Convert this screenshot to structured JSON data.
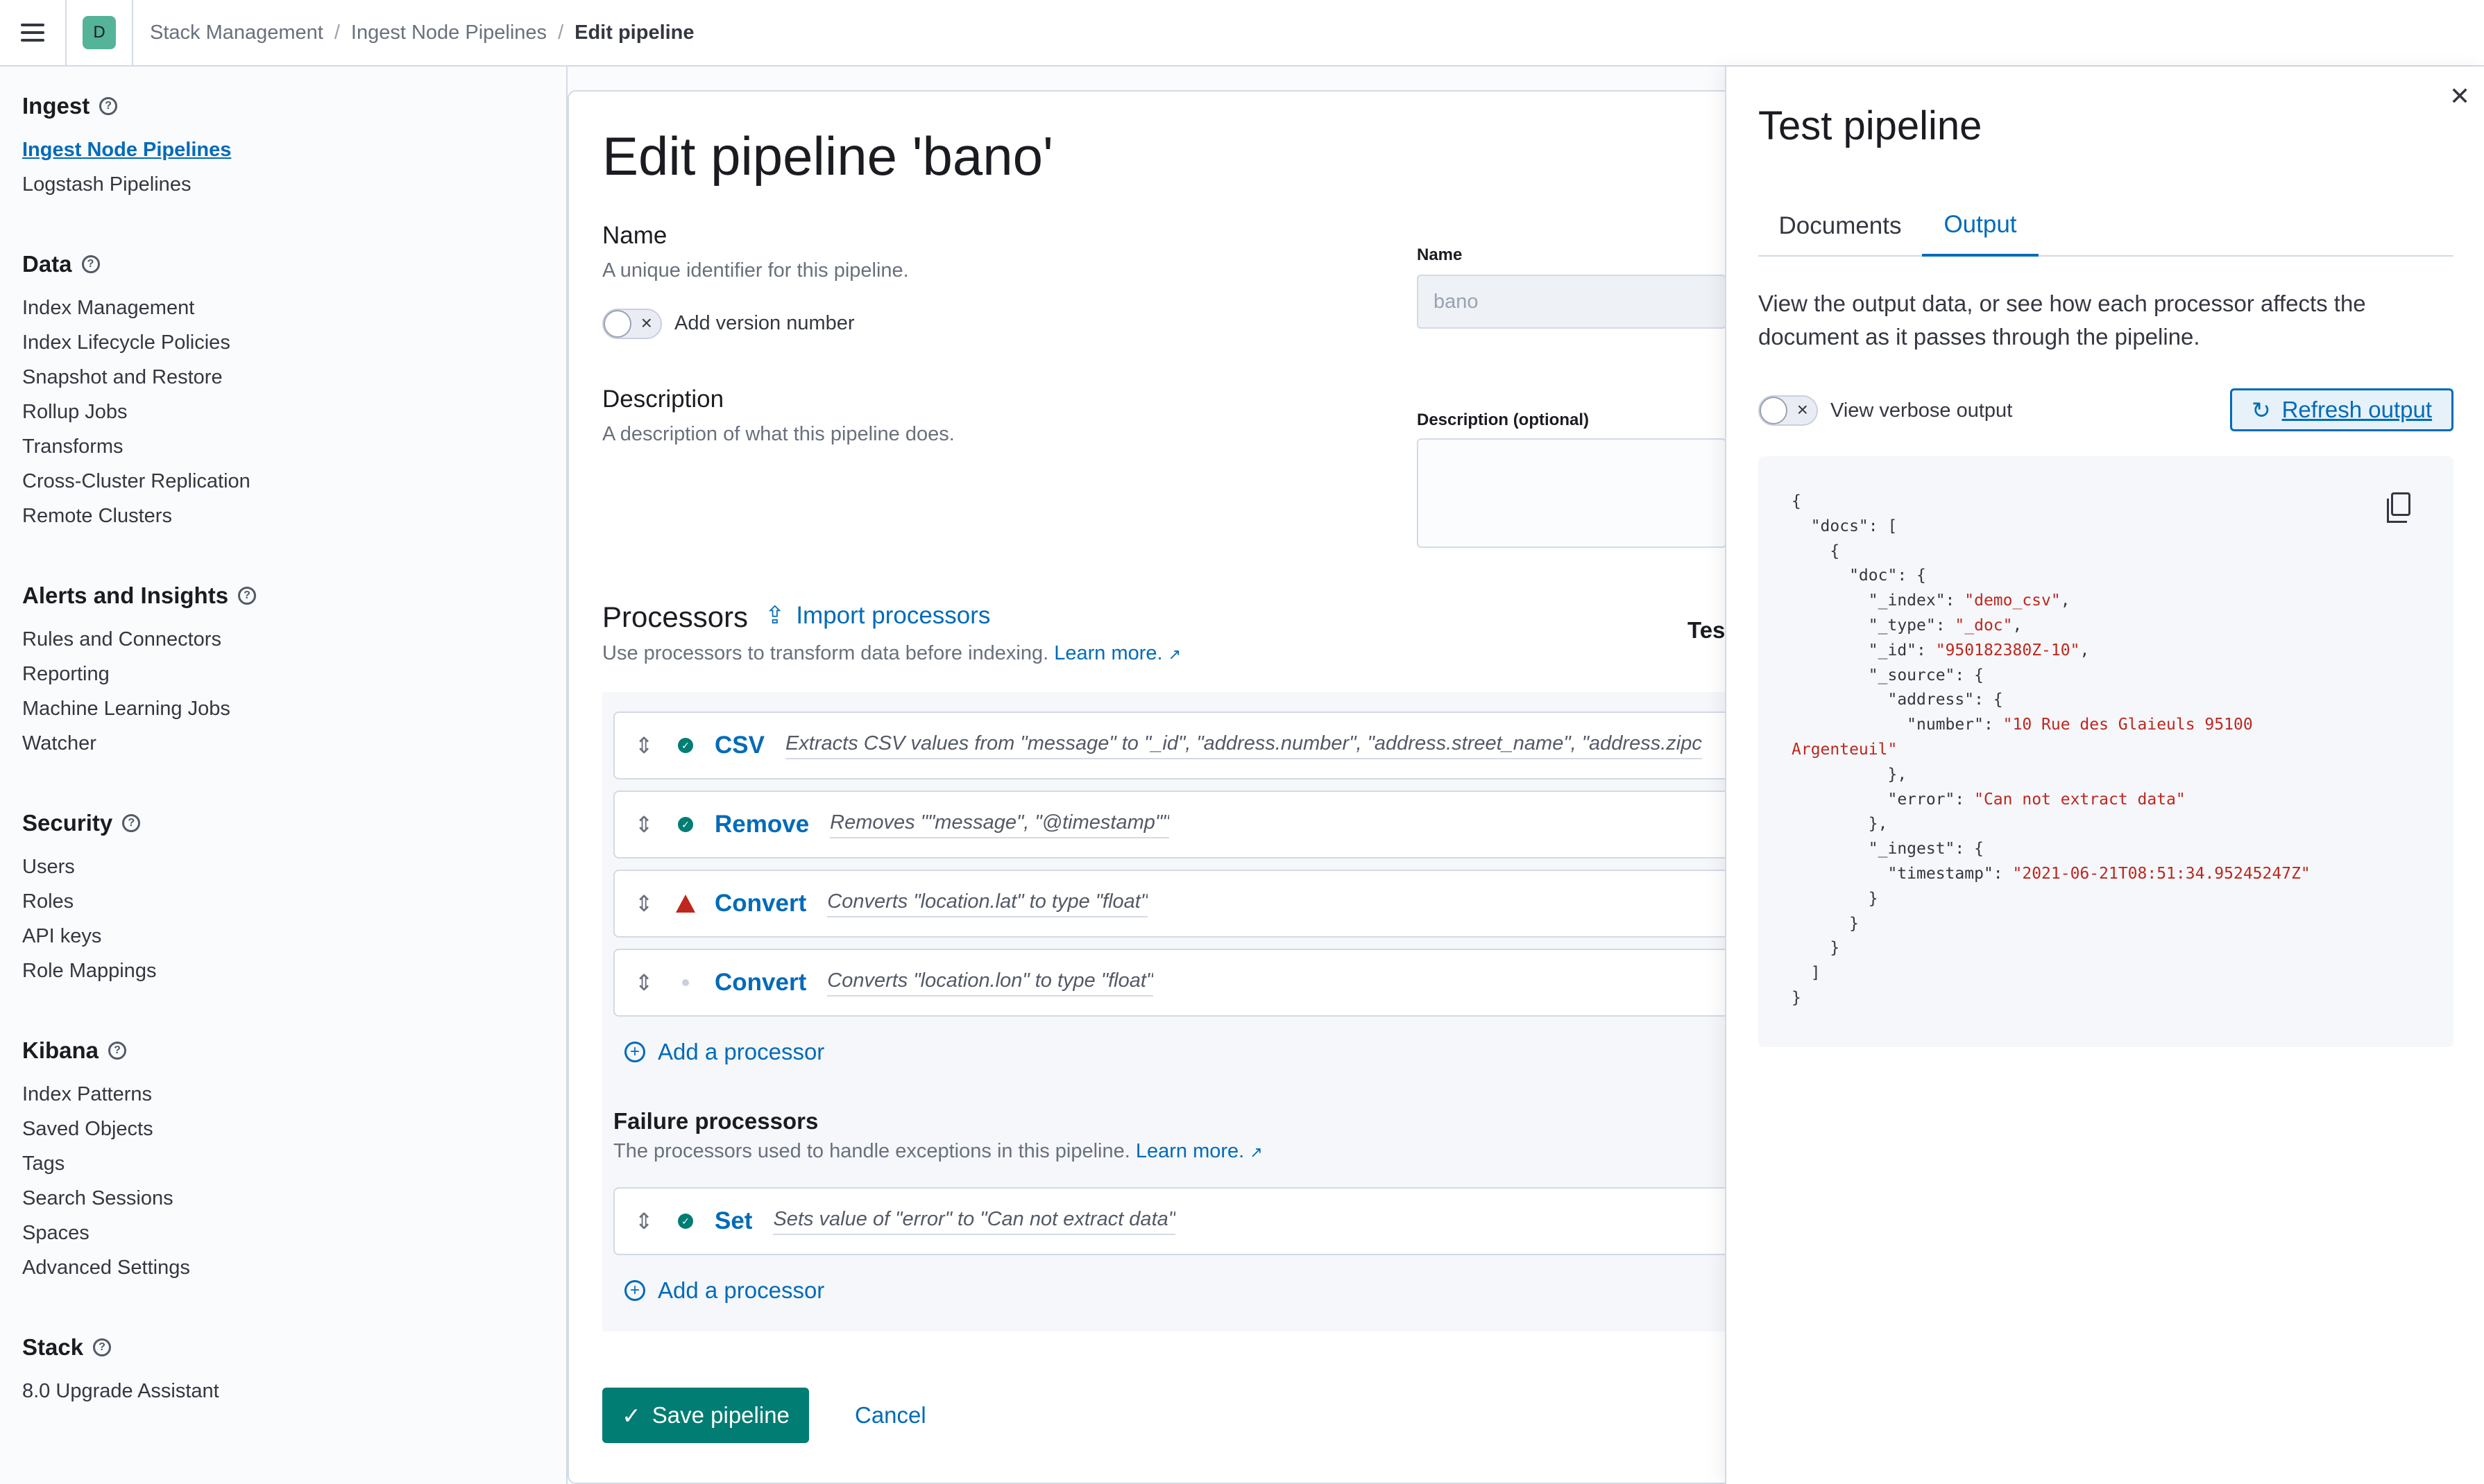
{
  "header": {
    "space_initial": "D",
    "breadcrumbs": [
      "Stack Management",
      "Ingest Node Pipelines",
      "Edit pipeline"
    ],
    "separator": "/"
  },
  "sidebar": {
    "sections": [
      {
        "title": "Ingest",
        "items": [
          "Ingest Node Pipelines",
          "Logstash Pipelines"
        ]
      },
      {
        "title": "Data",
        "items": [
          "Index Management",
          "Index Lifecycle Policies",
          "Snapshot and Restore",
          "Rollup Jobs",
          "Transforms",
          "Cross-Cluster Replication",
          "Remote Clusters"
        ]
      },
      {
        "title": "Alerts and Insights",
        "items": [
          "Rules and Connectors",
          "Reporting",
          "Machine Learning Jobs",
          "Watcher"
        ]
      },
      {
        "title": "Security",
        "items": [
          "Users",
          "Roles",
          "API keys",
          "Role Mappings"
        ]
      },
      {
        "title": "Kibana",
        "items": [
          "Index Patterns",
          "Saved Objects",
          "Tags",
          "Search Sessions",
          "Spaces",
          "Advanced Settings"
        ]
      },
      {
        "title": "Stack",
        "items": [
          "8.0 Upgrade Assistant"
        ]
      }
    ],
    "help_glyph": "?"
  },
  "form": {
    "page_title": "Edit pipeline 'bano'",
    "name_title": "Name",
    "name_desc": "A unique identifier for this pipeline.",
    "version_toggle_label": "Add version number",
    "name_label": "Name",
    "name_value": "bano",
    "description_title": "Description",
    "description_desc": "A description of what this pipeline does.",
    "description_label": "Description (optional)",
    "processors_title": "Processors",
    "import_label": "Import processors",
    "processors_desc": "Use processors to transform data before indexing.",
    "learn_more": "Learn more.",
    "test_cut": "Tes",
    "processors": [
      {
        "name": "CSV",
        "status": "ok",
        "desc": "Extracts CSV values from \"message\" to \"_id\", \"address.number\", \"address.street_name\", \"address.zipc"
      },
      {
        "name": "Remove",
        "status": "ok",
        "desc": "Removes \"\"message\", \"@timestamp\"\""
      },
      {
        "name": "Convert",
        "status": "error",
        "desc": "Converts \"location.lat\" to type \"float\""
      },
      {
        "name": "Convert",
        "status": "inactive",
        "desc": "Converts \"location.lon\" to type \"float\""
      }
    ],
    "add_processor": "Add a processor",
    "failure_title": "Failure processors",
    "failure_desc": "The processors used to handle exceptions in this pipeline.",
    "failure_processors": [
      {
        "name": "Set",
        "status": "ok",
        "desc": "Sets value of \"error\" to \"Can not extract data\""
      }
    ],
    "save_label": "Save pipeline",
    "cancel_label": "Cancel"
  },
  "flyout": {
    "title": "Test pipeline",
    "tabs": [
      "Documents",
      "Output"
    ],
    "selected_tab": "Output",
    "description": "View the output data, or see how each processor affects the document as it passes through the pipeline.",
    "verbose_label": "View verbose output",
    "refresh_label": "Refresh output",
    "output": {
      "index": "\"demo_csv\"",
      "type": "\"_doc\"",
      "id": "\"950182380Z-10\"",
      "number": "\"10 Rue des Glaieuls 95100",
      "number_cont": "Argenteuil\"",
      "error": "\"Can not extract data\"",
      "timestamp": "\"2021-06-21T08:51:34.95245247Z\""
    }
  }
}
